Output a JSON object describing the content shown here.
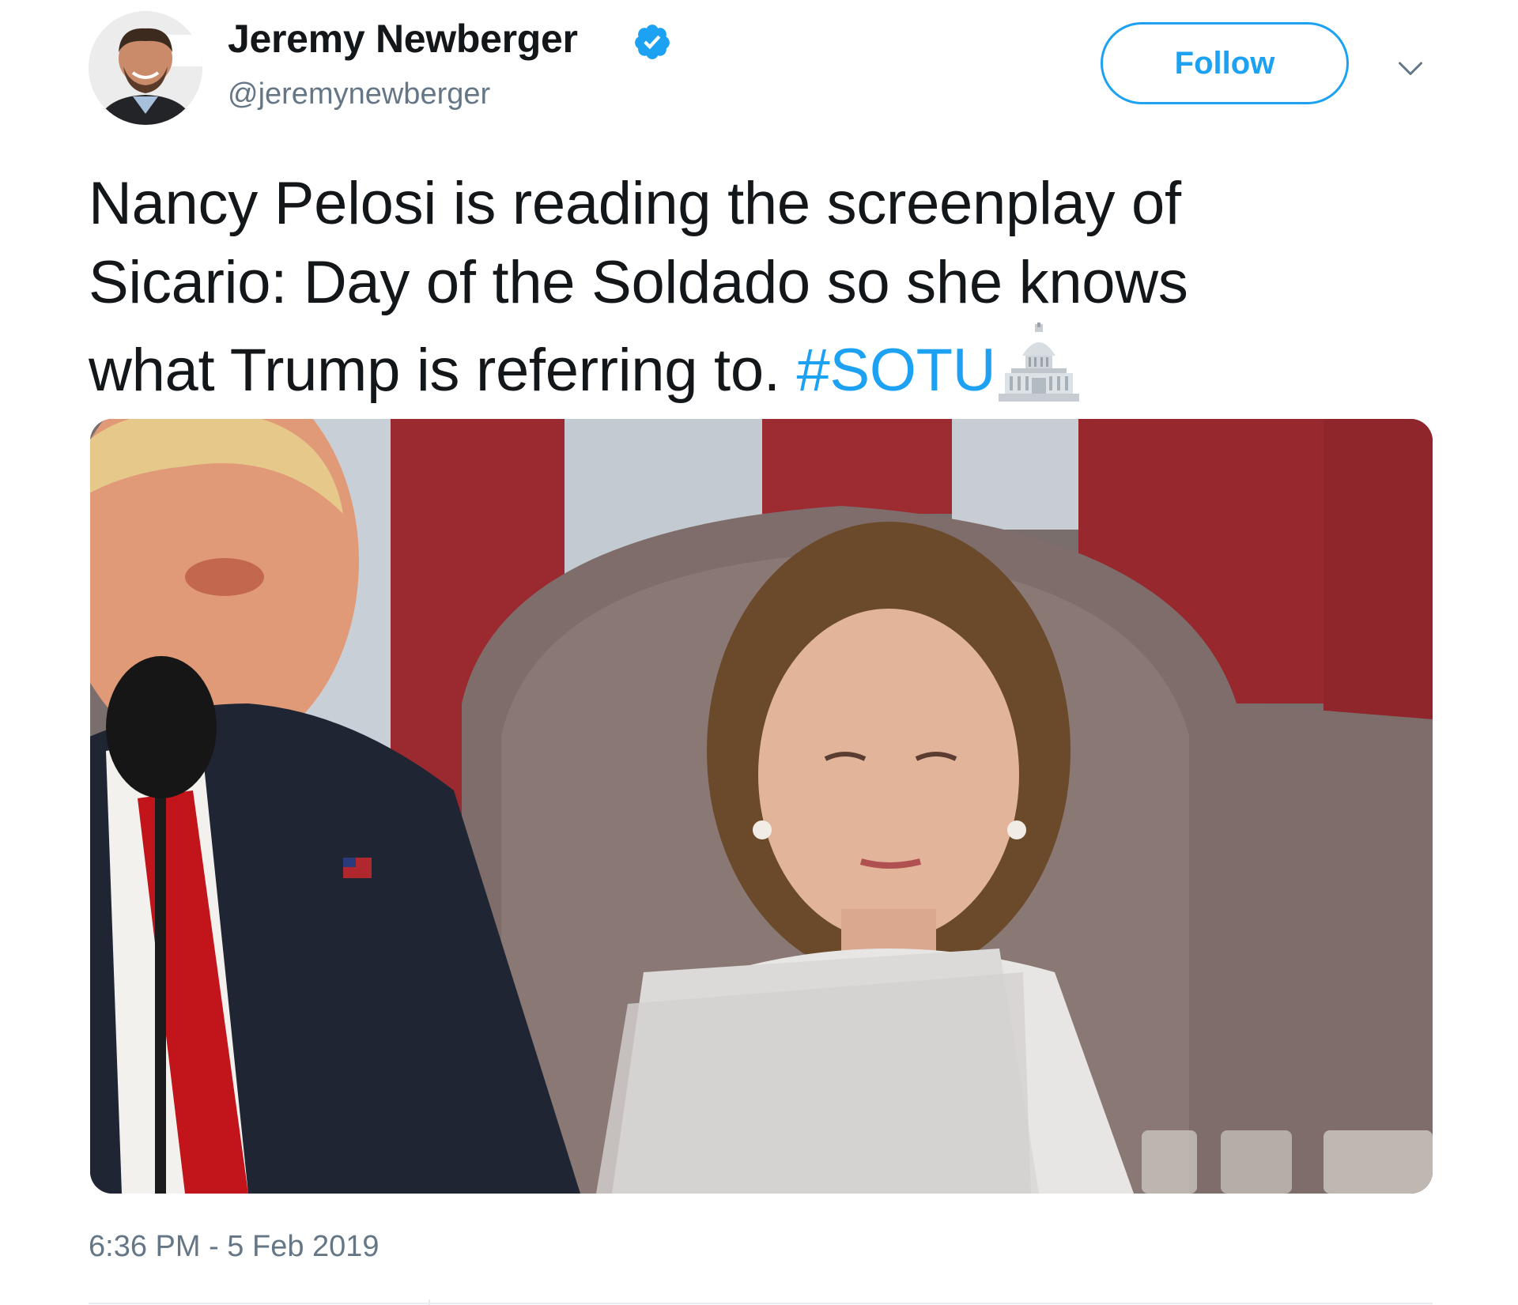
{
  "author": {
    "name": "Jeremy Newberger",
    "handle": "@jeremynewberger",
    "verified": true,
    "avatar_icon": "profile-photo"
  },
  "follow_button": {
    "label": "Follow"
  },
  "menu": {
    "icon": "chevron-down-icon"
  },
  "tweet": {
    "line1": "Nancy Pelosi is reading the screenplay of",
    "line2": "Sicario: Day of the Soldado so she knows",
    "line3_text": "what Trump is referring to. ",
    "hashtag": "#SOTU",
    "emoji": "capitol-building-icon"
  },
  "media": {
    "icon": "embedded-photo"
  },
  "timestamp": "6:36 PM - 5 Feb 2019",
  "colors": {
    "accent": "#1da1f2",
    "text": "#14171a",
    "secondary": "#657786"
  }
}
